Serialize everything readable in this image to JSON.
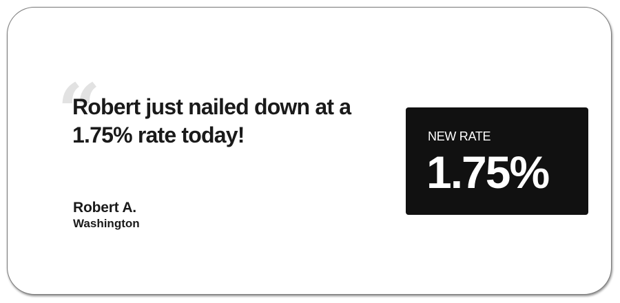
{
  "testimonial": {
    "quote_mark": "“",
    "quote": "Robert just nailed down at a 1.75% rate today!",
    "author_name": "Robert A.",
    "author_location": "Washington"
  },
  "rate_card": {
    "label": "NEW RATE",
    "value": "1.75%"
  },
  "colors": {
    "text": "#1a1a1a",
    "rate_box_background": "#111111",
    "quote_mark": "#e2e2e2"
  }
}
